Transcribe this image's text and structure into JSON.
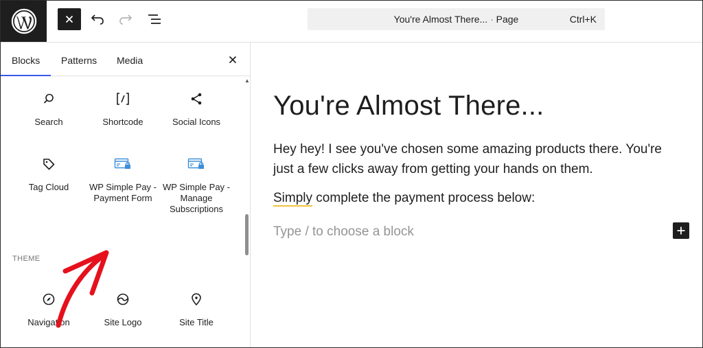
{
  "header": {
    "document_title": "You're Almost There...",
    "separator": "·",
    "document_type": "Page",
    "shortcut": "Ctrl+K"
  },
  "sidebar": {
    "tabs": [
      {
        "label": "Blocks",
        "active": true
      },
      {
        "label": "Patterns",
        "active": false
      },
      {
        "label": "Media",
        "active": false
      }
    ],
    "blocks": [
      {
        "label": "Search",
        "icon": "search-icon"
      },
      {
        "label": "Shortcode",
        "icon": "shortcode-icon"
      },
      {
        "label": "Social Icons",
        "icon": "share-icon"
      },
      {
        "label": "Tag Cloud",
        "icon": "tag-icon"
      },
      {
        "label": "WP Simple Pay - Payment Form",
        "icon": "payment-form-icon"
      },
      {
        "label": "WP Simple Pay - Manage Subscriptions",
        "icon": "payment-form-icon"
      }
    ],
    "section_label": "THEME",
    "theme_blocks": [
      {
        "label": "Navigation",
        "icon": "compass-icon"
      },
      {
        "label": "Site Logo",
        "icon": "site-logo-icon"
      },
      {
        "label": "Site Title",
        "icon": "map-marker-icon"
      }
    ]
  },
  "canvas": {
    "title": "You're Almost There...",
    "paragraph1": "Hey hey! I see you've chosen some amazing products there. You're just a few clicks away from getting your hands on them.",
    "paragraph2_word": "Simply",
    "paragraph2_rest": " complete the payment process below:",
    "placeholder": "Type / to choose a block"
  },
  "colors": {
    "accent": "#3858e9",
    "payment_icon": "#3d8fd8",
    "annotation_arrow": "#e5111c"
  }
}
